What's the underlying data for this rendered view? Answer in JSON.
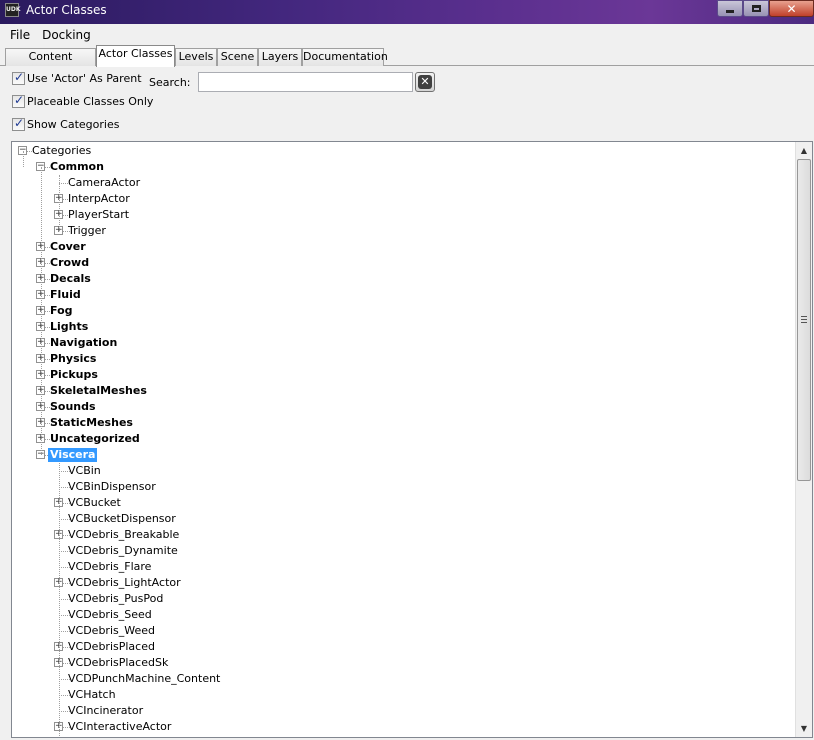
{
  "window": {
    "title": "Actor Classes",
    "icon_text": "UDK"
  },
  "menu": [
    "File",
    "Docking"
  ],
  "tabs": [
    "Content Browser",
    "Actor Classes",
    "Levels",
    "Scene",
    "Layers",
    "Documentation"
  ],
  "active_tab": "Actor Classes",
  "options": {
    "use_actor_parent": {
      "label": "Use 'Actor' As Parent",
      "checked": true
    },
    "placeable_only": {
      "label": "Placeable Classes Only",
      "checked": true
    },
    "show_categories": {
      "label": "Show Categories",
      "checked": true
    }
  },
  "search": {
    "label": "Search:",
    "value": ""
  },
  "tree": {
    "root": "Categories",
    "rows": [
      {
        "label": "Categories",
        "depth": 0,
        "expander": "minus",
        "bold": false
      },
      {
        "label": "Common",
        "depth": 1,
        "expander": "minus",
        "bold": true
      },
      {
        "label": "CameraActor",
        "depth": 2,
        "expander": "none",
        "bold": false
      },
      {
        "label": "InterpActor",
        "depth": 2,
        "expander": "plus",
        "bold": false
      },
      {
        "label": "PlayerStart",
        "depth": 2,
        "expander": "plus",
        "bold": false
      },
      {
        "label": "Trigger",
        "depth": 2,
        "expander": "plus",
        "bold": false
      },
      {
        "label": "Cover",
        "depth": 1,
        "expander": "plus",
        "bold": true
      },
      {
        "label": "Crowd",
        "depth": 1,
        "expander": "plus",
        "bold": true
      },
      {
        "label": "Decals",
        "depth": 1,
        "expander": "plus",
        "bold": true
      },
      {
        "label": "Fluid",
        "depth": 1,
        "expander": "plus",
        "bold": true
      },
      {
        "label": "Fog",
        "depth": 1,
        "expander": "plus",
        "bold": true
      },
      {
        "label": "Lights",
        "depth": 1,
        "expander": "plus",
        "bold": true
      },
      {
        "label": "Navigation",
        "depth": 1,
        "expander": "plus",
        "bold": true
      },
      {
        "label": "Physics",
        "depth": 1,
        "expander": "plus",
        "bold": true
      },
      {
        "label": "Pickups",
        "depth": 1,
        "expander": "plus",
        "bold": true
      },
      {
        "label": "SkeletalMeshes",
        "depth": 1,
        "expander": "plus",
        "bold": true
      },
      {
        "label": "Sounds",
        "depth": 1,
        "expander": "plus",
        "bold": true
      },
      {
        "label": "StaticMeshes",
        "depth": 1,
        "expander": "plus",
        "bold": true
      },
      {
        "label": "Uncategorized",
        "depth": 1,
        "expander": "plus",
        "bold": true
      },
      {
        "label": "Viscera",
        "depth": 1,
        "expander": "minus",
        "bold": true,
        "selected": true
      },
      {
        "label": "VCBin",
        "depth": 2,
        "expander": "none",
        "bold": false
      },
      {
        "label": "VCBinDispensor",
        "depth": 2,
        "expander": "none",
        "bold": false
      },
      {
        "label": "VCBucket",
        "depth": 2,
        "expander": "plus",
        "bold": false
      },
      {
        "label": "VCBucketDispensor",
        "depth": 2,
        "expander": "none",
        "bold": false
      },
      {
        "label": "VCDebris_Breakable",
        "depth": 2,
        "expander": "plus",
        "bold": false
      },
      {
        "label": "VCDebris_Dynamite",
        "depth": 2,
        "expander": "none",
        "bold": false
      },
      {
        "label": "VCDebris_Flare",
        "depth": 2,
        "expander": "none",
        "bold": false
      },
      {
        "label": "VCDebris_LightActor",
        "depth": 2,
        "expander": "plus",
        "bold": false
      },
      {
        "label": "VCDebris_PusPod",
        "depth": 2,
        "expander": "none",
        "bold": false
      },
      {
        "label": "VCDebris_Seed",
        "depth": 2,
        "expander": "none",
        "bold": false
      },
      {
        "label": "VCDebris_Weed",
        "depth": 2,
        "expander": "none",
        "bold": false
      },
      {
        "label": "VCDebrisPlaced",
        "depth": 2,
        "expander": "plus",
        "bold": false
      },
      {
        "label": "VCDebrisPlacedSk",
        "depth": 2,
        "expander": "plus",
        "bold": false
      },
      {
        "label": "VCDPunchMachine_Content",
        "depth": 2,
        "expander": "none",
        "bold": false
      },
      {
        "label": "VCHatch",
        "depth": 2,
        "expander": "none",
        "bold": false
      },
      {
        "label": "VCIncinerator",
        "depth": 2,
        "expander": "none",
        "bold": false
      },
      {
        "label": "VCInteractiveActor",
        "depth": 2,
        "expander": "plus",
        "bold": false
      }
    ]
  },
  "colors": {
    "selection": "#3399ff",
    "titlebar": "#43277e"
  }
}
